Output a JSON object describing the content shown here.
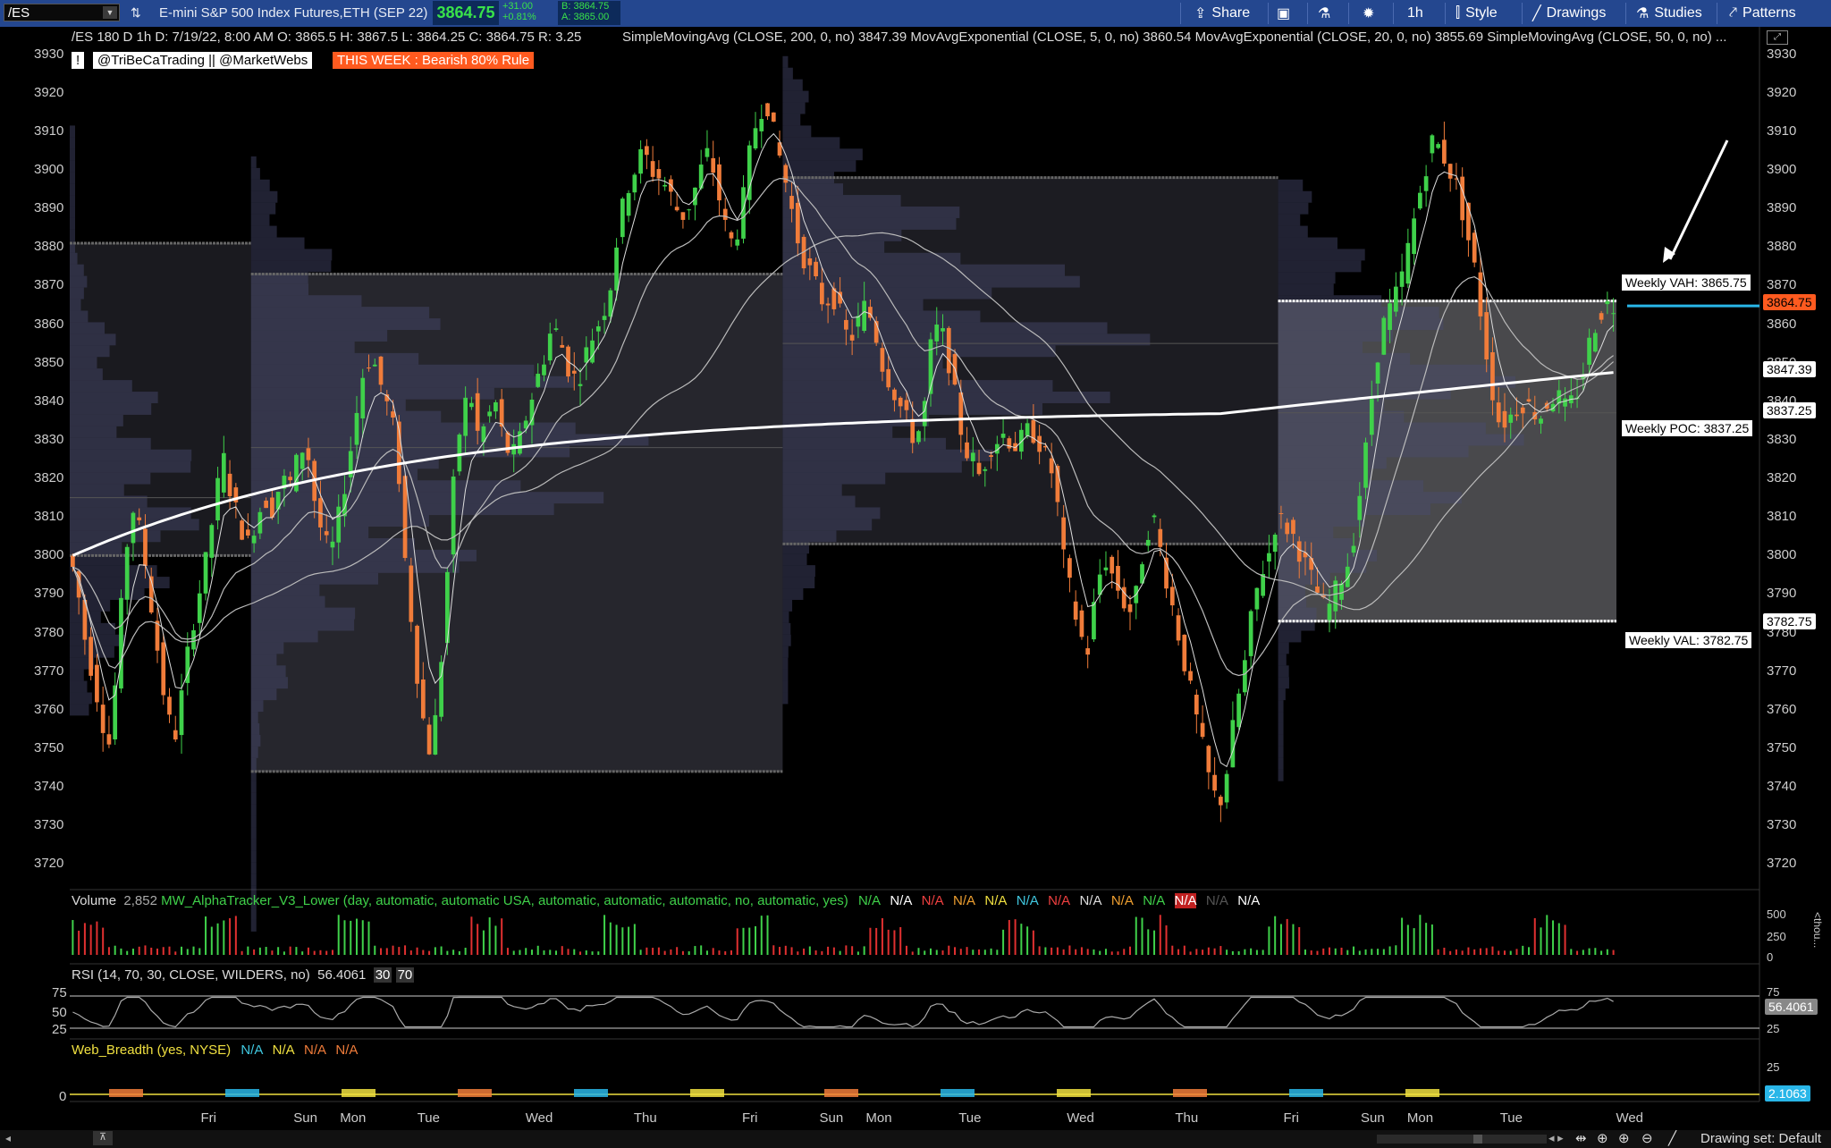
{
  "toolbar": {
    "symbol": "/ES",
    "description": "E-mini S&P 500 Index Futures,ETH (SEP 22)",
    "last": "3864.75",
    "change_abs": "+31.00",
    "change_pct": "+0.81%",
    "bid": "B: 3864.75",
    "ask": "A: 3865.00",
    "buttons": {
      "share": "Share",
      "interval": "1h",
      "style": "Style",
      "drawings": "Drawings",
      "studies": "Studies",
      "patterns": "Patterns"
    }
  },
  "header": {
    "ohlc": "/ES 180 D 1h   D: 7/19/22, 8:00 AM   O: 3865.5   H: 3867.5   L: 3864.25   C: 3864.75   R: 3.25",
    "studies": "SimpleMovingAvg (CLOSE, 200, 0, no)  3847.39   MovAvgExponential (CLOSE, 5, 0, no)  3860.54   MovAvgExponential (CLOSE, 20, 0, no)  3855.69   SimpleMovingAvg (CLOSE, 50, 0, no)  ...",
    "author": "@TriBeCaTrading || @MarketWebs",
    "rule": "THIS WEEK : Bearish 80% Rule"
  },
  "colors": {
    "up": "#3fd14a",
    "down": "#f07c3a",
    "toolbar": "#24478f",
    "accent": "#ff5a1f"
  },
  "yaxis": {
    "ticks": [
      "3930",
      "3920",
      "3910",
      "3900",
      "3890",
      "3880",
      "3870",
      "3860",
      "3850",
      "3840",
      "3830",
      "3820",
      "3810",
      "3800",
      "3790",
      "3780",
      "3770",
      "3760",
      "3750",
      "3740",
      "3730",
      "3720"
    ]
  },
  "price_markers": {
    "last": "3864.75",
    "sma200": "3847.39",
    "poc": "3837.25",
    "val": "3782.75"
  },
  "notes": {
    "vah": "Weekly VAH: 3865.75",
    "poc": "Weekly POC: 3837.25",
    "val": "Weekly VAL: 3782.75"
  },
  "volume": {
    "label": "Volume",
    "value": "2,852",
    "study": "MW_AlphaTracker_V3_Lower (day, automatic, automatic USA, automatic, automatic, automatic, no, automatic, yes)",
    "na": [
      "N/A",
      "N/A",
      "N/A",
      "N/A",
      "N/A",
      "N/A",
      "N/A",
      "N/A",
      "N/A",
      "N/A",
      "N/A",
      "N/A",
      "N/A"
    ],
    "ticks": [
      "500",
      "250",
      "0"
    ],
    "unit": "<thou..."
  },
  "rsi": {
    "label": "RSI (14, 70, 30, CLOSE, WILDERS, no)",
    "value": "56.4061",
    "lo": "30",
    "hi": "70",
    "ticks": [
      "75",
      "50",
      "25"
    ]
  },
  "breadth": {
    "label": "Web_Breadth (yes, NYSE)",
    "na": [
      "N/A",
      "N/A",
      "N/A",
      "N/A"
    ],
    "ticks": [
      "25",
      "0"
    ],
    "value": "2.1063"
  },
  "xaxis": {
    "days": [
      "Fri",
      "Sun",
      "Mon",
      "Tue",
      "Wed",
      "Thu",
      "Fri",
      "Sun",
      "Mon",
      "Tue",
      "Wed",
      "Thu",
      "Fri",
      "Sun",
      "Mon",
      "Tue",
      "Wed"
    ]
  },
  "footer": {
    "drawing_set": "Drawing set: Default"
  },
  "chart_data": {
    "type": "candlestick",
    "ylim": [
      3715,
      3932
    ],
    "sessions": [
      {
        "start": 0,
        "end": 30,
        "vah": 3881,
        "val": 3800,
        "poc": 3815
      },
      {
        "start": 30,
        "end": 118,
        "vah": 3873,
        "val": 3744,
        "poc": 3828
      },
      {
        "start": 118,
        "end": 200,
        "vah": 3898,
        "val": 3803,
        "poc": 3855
      },
      {
        "start": 200,
        "end": 256,
        "vah": 3866,
        "val": 3783,
        "poc": 3837
      }
    ],
    "path": [
      3800,
      3795,
      3780,
      3770,
      3760,
      3750,
      3770,
      3800,
      3812,
      3805,
      3790,
      3775,
      3760,
      3752,
      3765,
      3780,
      3790,
      3800,
      3815,
      3825,
      3815,
      3808,
      3803,
      3810,
      3815,
      3812,
      3820,
      3818,
      3825,
      3830,
      3815,
      3805,
      3800,
      3810,
      3822,
      3835,
      3848,
      3852,
      3845,
      3838,
      3830,
      3800,
      3780,
      3760,
      3750,
      3760,
      3790,
      3820,
      3838,
      3842,
      3830,
      3835,
      3840,
      3830,
      3825,
      3830,
      3838,
      3845,
      3852,
      3860,
      3855,
      3848,
      3845,
      3852,
      3858,
      3862,
      3870,
      3885,
      3895,
      3900,
      3905,
      3900,
      3898,
      3895,
      3890,
      3888,
      3893,
      3900,
      3905,
      3895,
      3885,
      3880,
      3890,
      3905,
      3915,
      3918,
      3908,
      3900,
      3890,
      3880,
      3875,
      3870,
      3865,
      3868,
      3862,
      3855,
      3860,
      3865,
      3860,
      3850,
      3845,
      3840,
      3835,
      3830,
      3835,
      3855,
      3860,
      3852,
      3840,
      3828,
      3825,
      3820,
      3828,
      3830,
      3832,
      3828,
      3830,
      3833,
      3830,
      3825,
      3820,
      3800,
      3790,
      3780,
      3775,
      3790,
      3800,
      3795,
      3790,
      3785,
      3790,
      3805,
      3810,
      3800,
      3790,
      3780,
      3770,
      3760,
      3750,
      3740,
      3735,
      3745,
      3760,
      3770,
      3785,
      3795,
      3800,
      3810,
      3808,
      3805,
      3800,
      3795,
      3790,
      3785,
      3790,
      3795,
      3800,
      3815,
      3830,
      3850,
      3860,
      3865,
      3870,
      3880,
      3890,
      3900,
      3908,
      3905,
      3900,
      3895,
      3885,
      3875,
      3860,
      3845,
      3835,
      3835,
      3838,
      3840,
      3838,
      3836,
      3840,
      3842,
      3838,
      3840,
      3845,
      3855,
      3862,
      3865,
      3864.75
    ]
  }
}
